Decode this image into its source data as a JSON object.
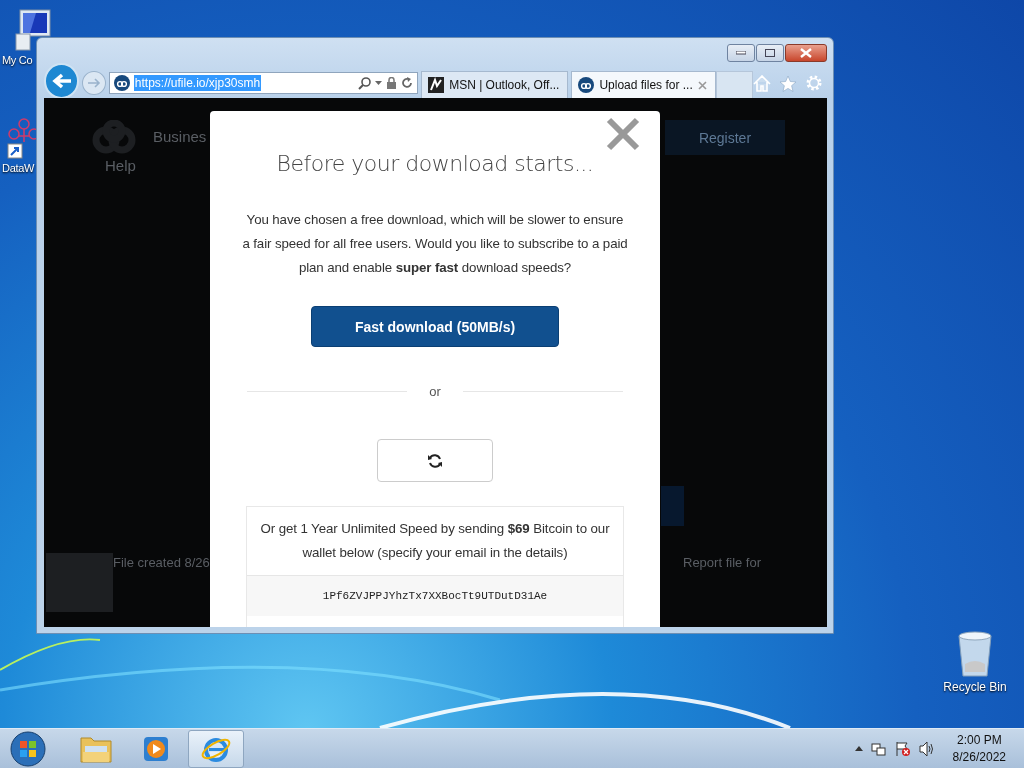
{
  "desktop_icons": [
    {
      "kind": "computer",
      "label": "My Co"
    },
    {
      "kind": "shortcut",
      "label": "DataW"
    },
    {
      "kind": "recycle-bin",
      "label": "Recycle Bin"
    }
  ],
  "browser": {
    "address_bar": {
      "url": "https://ufile.io/xjp30smh",
      "url_selected": true
    },
    "tabs": [
      {
        "label": "MSN | Outlook, Off...",
        "selected": false
      },
      {
        "label": "Upload files for ...",
        "selected": true
      }
    ],
    "background_page": {
      "nav": [
        "Busines",
        "Help"
      ],
      "register": "Register",
      "file_created": "File created  8/26",
      "report": "Report file for"
    },
    "modal": {
      "title": "Before your download starts...",
      "body": "You have chosen a free download, which will be slower to ensure a fair speed for all free users. Would you like to subscribe to a paid plan and enable **super fast** download speeds?",
      "primary_button": "Fast download (50MB/s)",
      "divider": "or",
      "bitcoin_text": "Or get 1 Year Unlimited Speed by sending **$69** Bitcoin to our wallet below (specify your email in the details)",
      "wallet": "1Pf6ZVJPPJYhzTx7XXBocTt9UTDutD31Ae"
    }
  },
  "taskbar": {
    "items": [
      {
        "kind": "explorer",
        "active": false
      },
      {
        "kind": "media-player",
        "active": false
      },
      {
        "kind": "internet-explorer",
        "active": true
      }
    ],
    "time": "2:00 PM",
    "date": "8/26/2022"
  }
}
